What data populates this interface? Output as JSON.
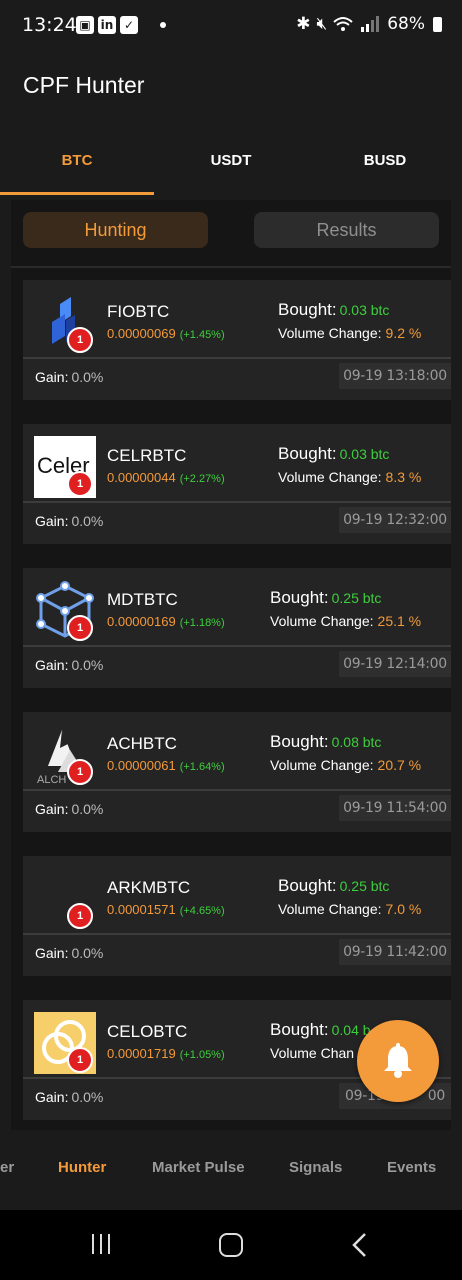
{
  "status": {
    "time": "13:24",
    "battery": "68%",
    "icons": [
      "gallery-icon",
      "linkedin-icon",
      "checkbox-icon",
      "bluetooth-icon",
      "mute-icon",
      "wifi-icon",
      "wifi-call-icon",
      "signal-icon"
    ]
  },
  "app": {
    "title": "CPF Hunter"
  },
  "tabs": [
    {
      "label": "BTC",
      "active": true
    },
    {
      "label": "USDT",
      "active": false
    },
    {
      "label": "BUSD",
      "active": false
    }
  ],
  "segments": {
    "hunting": "Hunting",
    "results": "Results"
  },
  "labels": {
    "bought": "Bought:",
    "volume_change": "Volume Change:",
    "gain": "Gain:"
  },
  "cards": [
    {
      "symbol": "FIOBTC",
      "price": "0.00000069",
      "change": "(+1.45%)",
      "bought": "0.03 btc",
      "volume_change": "9.2 %",
      "gain": "0.0%",
      "timestamp": "09-19 13:18:00",
      "badge": "1",
      "logo": "fio-logo"
    },
    {
      "symbol": "CELRBTC",
      "price": "0.00000044",
      "change": "(+2.27%)",
      "bought": "0.03 btc",
      "volume_change": "8.3 %",
      "gain": "0.0%",
      "timestamp": "09-19 12:32:00",
      "badge": "1",
      "logo": "celer-logo",
      "logo_text": "Celer"
    },
    {
      "symbol": "MDTBTC",
      "price": "0.00000169",
      "change": "(+1.18%)",
      "bought": "0.25 btc",
      "volume_change": "25.1 %",
      "gain": "0.0%",
      "timestamp": "09-19 12:14:00",
      "badge": "1",
      "logo": "mdt-logo"
    },
    {
      "symbol": "ACHBTC",
      "price": "0.00000061",
      "change": "(+1.64%)",
      "bought": "0.08 btc",
      "volume_change": "20.7 %",
      "gain": "0.0%",
      "timestamp": "09-19 11:54:00",
      "badge": "1",
      "logo": "alchemy-logo",
      "logo_text": "ALCH"
    },
    {
      "symbol": "ARKMBTC",
      "price": "0.00001571",
      "change": "(+4.65%)",
      "bought": "0.25 btc",
      "volume_change": "7.0 %",
      "gain": "0.0%",
      "timestamp": "09-19 11:42:00",
      "badge": "1",
      "logo": ""
    },
    {
      "symbol": "CELOBTC",
      "price": "0.00001719",
      "change": "(+1.05%)",
      "bought": "0.04 b",
      "volume_change": "",
      "volume_label": "Volume Chan",
      "gain": "0.0%",
      "timestamp": "09-19 1",
      "timestamp_tail": "00",
      "badge": "1",
      "logo": "celo-logo"
    }
  ],
  "bottom_nav": [
    {
      "label": "er",
      "active": false
    },
    {
      "label": "Hunter",
      "active": true
    },
    {
      "label": "Market Pulse",
      "active": false
    },
    {
      "label": "Signals",
      "active": false
    },
    {
      "label": "Events",
      "active": false
    }
  ],
  "colors": {
    "accent": "#f39a3a",
    "positive": "#3ccf3c",
    "badge": "#e02020",
    "background": "#1b1b1b",
    "card": "#242424"
  }
}
